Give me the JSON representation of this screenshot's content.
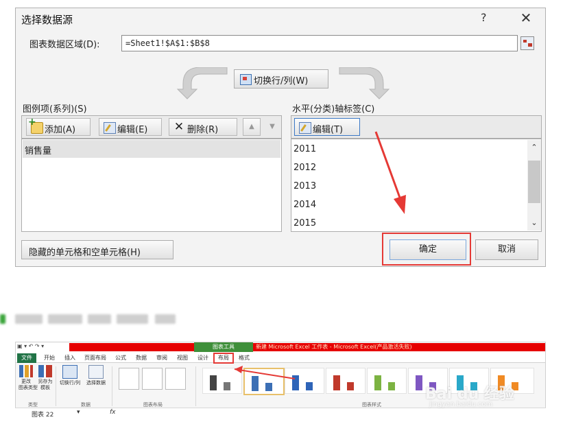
{
  "dialog": {
    "title": "选择数据源",
    "help": "?",
    "close": "✕",
    "range_label": "图表数据区域(D):",
    "range_value": "=Sheet1!$A$1:$B$8",
    "switch_label": "切换行/列(W)",
    "series_label": "图例项(系列)(S)",
    "axis_label": "水平(分类)轴标签(C)",
    "add_label": "添加(A)",
    "edit_label": "编辑(E)",
    "delete_label": "删除(R)",
    "up": "▲",
    "down": "▼",
    "axis_edit_label": "编辑(T)",
    "series_items": [
      "销售量"
    ],
    "axis_items": [
      "2011",
      "2012",
      "2013",
      "2014",
      "2015"
    ],
    "hidden_cells_label": "隐藏的单元格和空单元格(H)",
    "ok_label": "确定",
    "cancel_label": "取消"
  },
  "excel": {
    "tools_label": "图表工具",
    "window_title": "新建 Microsoft Excel 工作表 - Microsoft Excel(产品激活失败)",
    "tabs": [
      "文件",
      "开始",
      "插入",
      "页面布局",
      "公式",
      "数据",
      "审阅",
      "视图",
      "设计",
      "布局",
      "格式"
    ],
    "buttons": {
      "change_type": "更改\n图表类型",
      "save_template": "另存为\n模板",
      "switch_row_col": "切换行/列",
      "select_data": "选择数据"
    },
    "groups": {
      "type": "类型",
      "data": "数据",
      "chart_layout": "图表布局",
      "chart_styles": "图表样式"
    },
    "name_box": "图表 22",
    "fx": "fx"
  },
  "watermark": {
    "brand": "Bai du 经验",
    "url": "jingyan.baidu.com"
  },
  "colors": {
    "highlight_red": "#e53935",
    "excel_green": "#217346"
  }
}
